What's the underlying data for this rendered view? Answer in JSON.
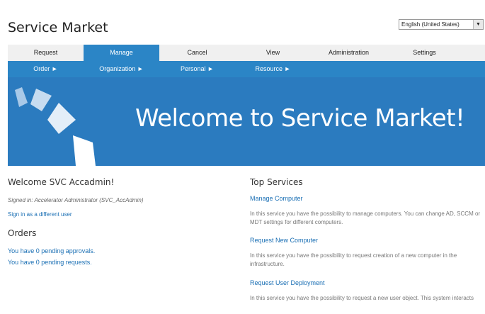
{
  "header": {
    "title": "Service Market",
    "language": "English (United States)"
  },
  "nav": {
    "tabs": [
      "Request",
      "Manage",
      "Cancel",
      "View",
      "Administration",
      "Settings"
    ],
    "active_index": 1
  },
  "subnav": {
    "items": [
      "Order ►",
      "Organization ►",
      "Personal ►",
      "Resource ►"
    ]
  },
  "banner": {
    "text": "Welcome to Service Market!"
  },
  "welcome": {
    "heading": "Welcome SVC Accadmin!",
    "signed_in": "Signed in: Accelerator Administrator (SVC_AccAdmin)",
    "sign_in_other": "Sign in as a different user"
  },
  "orders": {
    "heading": "Orders",
    "pending_approvals": "You have 0 pending approvals.",
    "pending_requests": "You have 0 pending requests."
  },
  "top_services": {
    "heading": "Top Services",
    "items": [
      {
        "title": "Manage Computer",
        "description": "In this service you have the possibility to manage computers. You can change AD, SCCM or MDT settings for different computers."
      },
      {
        "title": "Request New Computer",
        "description": "In this service you have the possibility to request creation of a new computer in the infrastructure."
      },
      {
        "title": "Request User Deployment",
        "description": "In this service you have the possibility to request a new user object. This system interacts"
      }
    ]
  },
  "colors": {
    "accent": "#2b85c6",
    "link": "#1a6fb4",
    "banner": "#2b7bbf"
  }
}
